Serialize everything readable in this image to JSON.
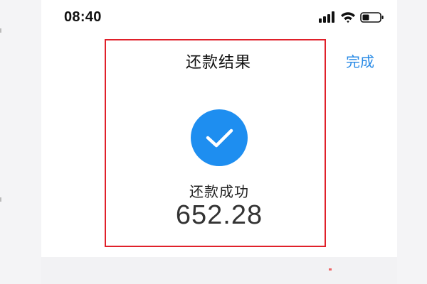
{
  "status_bar": {
    "time": "08:40",
    "icons": [
      "signal-icon",
      "wifi-icon",
      "battery-icon"
    ]
  },
  "nav": {
    "title": "还款结果",
    "done_label": "完成"
  },
  "result": {
    "icon": "check-circle-icon",
    "status_text": "还款成功",
    "amount": "652.28"
  },
  "colors": {
    "accent": "#2a8be6",
    "check_circle": "#1e8ef0",
    "annotation_box": "#e0202a"
  }
}
